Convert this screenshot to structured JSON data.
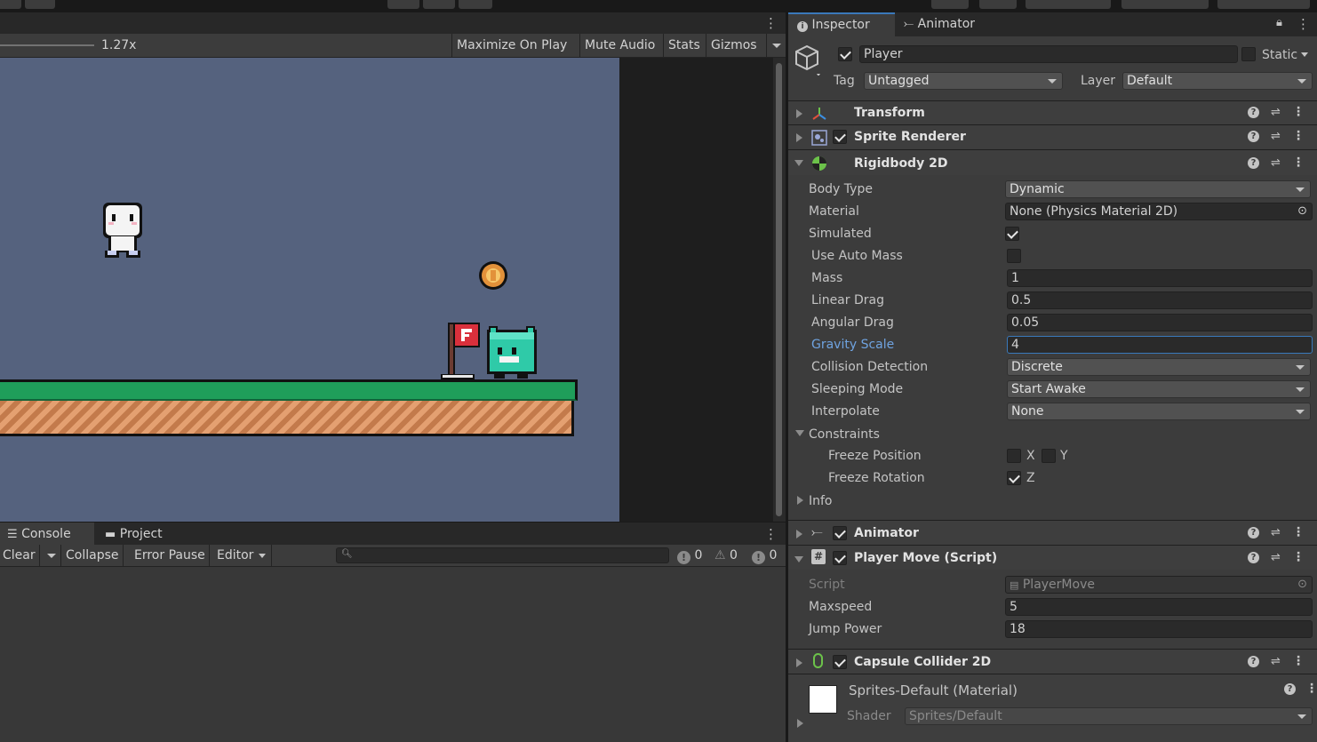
{
  "game": {
    "zoom": "1.27x",
    "toolbar": {
      "maximize": "Maximize On Play",
      "mute": "Mute Audio",
      "stats": "Stats",
      "gizmos": "Gizmos"
    }
  },
  "console": {
    "tabs": {
      "console": "Console",
      "project": "Project"
    },
    "toolbar": {
      "clear": "Clear",
      "collapse": "Collapse",
      "error_pause": "Error Pause",
      "editor": "Editor"
    },
    "counts": {
      "log": "0",
      "warn": "0",
      "error": "0"
    }
  },
  "inspector": {
    "tabs": {
      "inspector": "Inspector",
      "animator": "Animator"
    },
    "object": {
      "name": "Player",
      "static_label": "Static",
      "tag_label": "Tag",
      "tag": "Untagged",
      "layer_label": "Layer",
      "layer": "Default"
    },
    "components": {
      "transform": "Transform",
      "sprite_renderer": "Sprite Renderer",
      "rigidbody": "Rigidbody 2D",
      "animator": "Animator",
      "player_move": "Player Move (Script)",
      "capsule": "Capsule Collider 2D"
    },
    "rigidbody": {
      "body_type_label": "Body Type",
      "body_type": "Dynamic",
      "material_label": "Material",
      "material": "None (Physics Material 2D)",
      "simulated_label": "Simulated",
      "auto_mass_label": "Use Auto Mass",
      "mass_label": "Mass",
      "mass": "1",
      "linear_drag_label": "Linear Drag",
      "linear_drag": "0.5",
      "angular_drag_label": "Angular Drag",
      "angular_drag": "0.05",
      "gravity_label": "Gravity Scale",
      "gravity": "4",
      "collision_label": "Collision Detection",
      "collision": "Discrete",
      "sleeping_label": "Sleeping Mode",
      "sleeping": "Start Awake",
      "interpolate_label": "Interpolate",
      "interpolate": "None",
      "constraints_label": "Constraints",
      "freeze_pos_label": "Freeze Position",
      "x": "X",
      "y": "Y",
      "freeze_rot_label": "Freeze Rotation",
      "z": "Z",
      "info_label": "Info"
    },
    "player_move": {
      "script_label": "Script",
      "script": "PlayerMove",
      "maxspeed_label": "Maxspeed",
      "maxspeed": "5",
      "jump_label": "Jump Power",
      "jump": "18"
    },
    "material": {
      "name": "Sprites-Default (Material)",
      "shader_label": "Shader",
      "shader": "Sprites/Default"
    }
  },
  "colors": {
    "accent": "#3a79bb",
    "game_bg": "#55627e",
    "grass": "#1f9e5a"
  }
}
